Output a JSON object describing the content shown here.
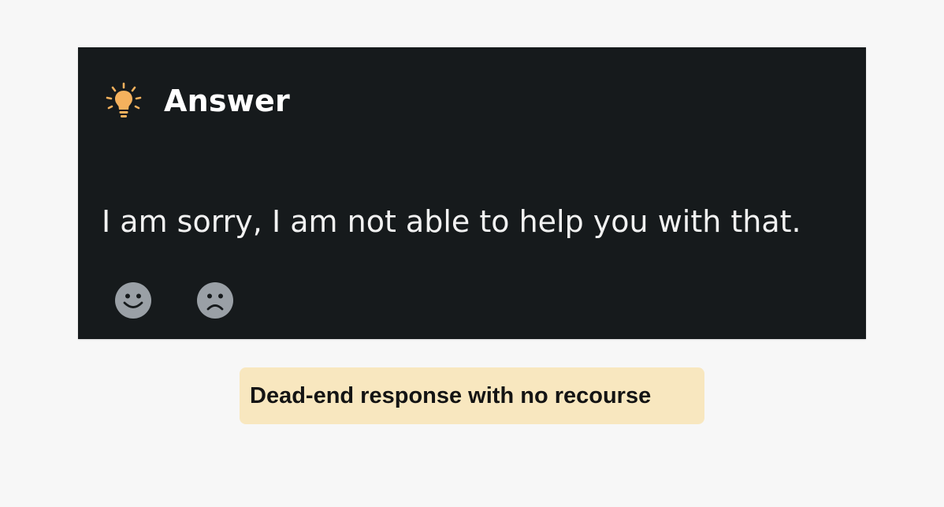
{
  "card": {
    "title": "Answer",
    "icon": "lightbulb-icon",
    "message": "I am sorry, I am not able to help you with that.",
    "feedback": {
      "positive_icon": "smiley-face-icon",
      "negative_icon": "frowning-face-icon"
    }
  },
  "caption": {
    "text": "Dead-end response with no recourse"
  },
  "colors": {
    "card_background": "#161a1c",
    "bulb": "#f5b15d",
    "feedback_icon": "#9aa0a6",
    "caption_background": "#f8e7bf",
    "page_background": "#f7f7f7"
  }
}
